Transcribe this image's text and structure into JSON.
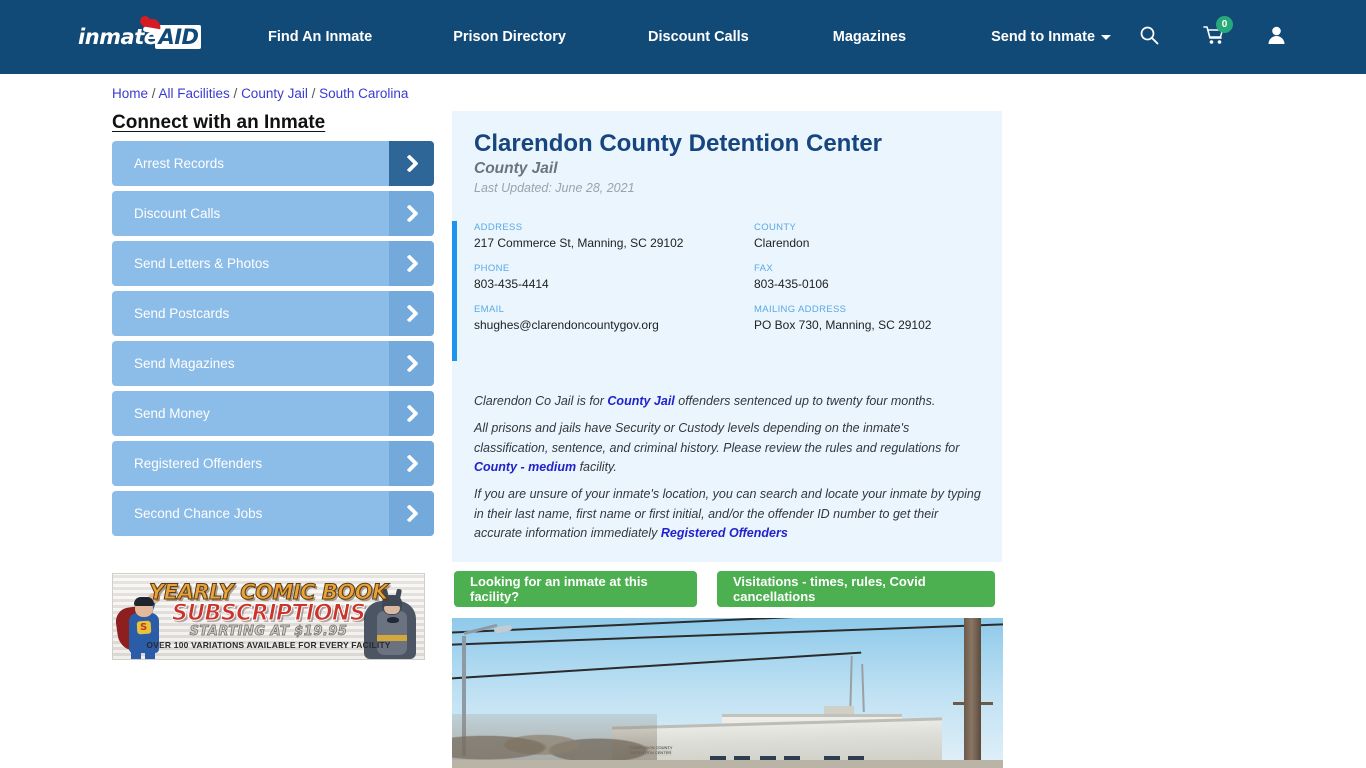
{
  "brand": {
    "logo_text": "inmate",
    "logo_accent": "AID",
    "header_bg": "#124a77"
  },
  "nav": {
    "links": [
      {
        "label": "Find An Inmate"
      },
      {
        "label": "Prison Directory"
      },
      {
        "label": "Discount Calls"
      },
      {
        "label": "Magazines"
      },
      {
        "label": "Send to Inmate"
      }
    ],
    "icons": {
      "search": "search-icon",
      "cart": "cart-icon",
      "user": "user-icon"
    },
    "cart_count": "0",
    "cart_badge_color": "#28a97b"
  },
  "breadcrumb": {
    "items": [
      "Home",
      "All Facilities",
      "County Jail",
      "South Carolina"
    ],
    "separator": "/",
    "link_color": "#3b3bd0"
  },
  "sidebar": {
    "title": "Connect with an Inmate",
    "items": [
      {
        "label": "Arrest Records",
        "active": true
      },
      {
        "label": "Discount Calls",
        "active": false
      },
      {
        "label": "Send Letters & Photos",
        "active": false
      },
      {
        "label": "Send Postcards",
        "active": false
      },
      {
        "label": "Send Magazines",
        "active": false
      },
      {
        "label": "Send Money",
        "active": false
      },
      {
        "label": "Registered Offenders",
        "active": false
      },
      {
        "label": "Second Chance Jobs",
        "active": false
      }
    ]
  },
  "ad": {
    "line1": "YEARLY COMIC BOOK",
    "line2": "SUBSCRIPTIONS",
    "line3": "STARTING AT $19.95",
    "line4": "OVER 100 VARIATIONS AVAILABLE FOR EVERY FACILITY"
  },
  "facility": {
    "name": "Clarendon County Detention Center",
    "type": "County Jail",
    "last_updated": "Last Updated: June 28, 2021",
    "accent_color": "#1f94ef",
    "card_bg": "#eaf5fd",
    "info": [
      {
        "label": "ADDRESS",
        "value": "217 Commerce St, Manning, SC 29102"
      },
      {
        "label": "COUNTY",
        "value": "Clarendon"
      },
      {
        "label": "PHONE",
        "value": "803-435-4414"
      },
      {
        "label": "FAX",
        "value": "803-435-0106"
      },
      {
        "label": "EMAIL",
        "value": "shughes@clarendoncountygov.org"
      },
      {
        "label": "MAILING ADDRESS",
        "value": "PO Box 730, Manning, SC 29102"
      }
    ],
    "paragraph1_pre": "Clarendon Co Jail is for ",
    "paragraph1_link": "County Jail",
    "paragraph1_post": " offenders sentenced up to twenty four months.",
    "paragraph2_pre": "All prisons and jails have Security or Custody levels depending on the inmate's classification, sentence, and criminal history. Please review the rules and regulations for ",
    "paragraph2_link": "County - medium",
    "paragraph2_post": " facility.",
    "paragraph3_pre": "If you are unsure of your inmate's location, you can search and locate your inmate by typing in their last name, first name or first initial, and/or the offender ID number to get their accurate information immediately ",
    "paragraph3_link": "Registered Offenders",
    "paragraph3_post": ""
  },
  "actions": {
    "button_color": "#4caf50",
    "inmate_search_label": "Looking for an inmate at this facility?",
    "visitation_label": "Visitations - times, rules, Covid cancellations"
  },
  "photo": {
    "caption": "CLARENDON COUNTY DETENTION CENTER"
  }
}
